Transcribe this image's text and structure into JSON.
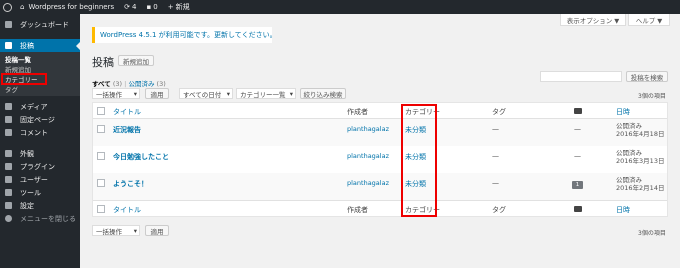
{
  "adminbar": {
    "site_name": "Wordpress for beginners",
    "updates": "4",
    "comments": "0",
    "new": "新規"
  },
  "sidebar": {
    "dashboard": "ダッシュボード",
    "posts": "投稿",
    "sub": [
      "投稿一覧",
      "新規追加",
      "カテゴリー",
      "タグ"
    ],
    "media": "メディア",
    "pages": "固定ページ",
    "comments": "コメント",
    "appearance": "外観",
    "plugins": "プラグイン",
    "users": "ユーザー",
    "tools": "ツール",
    "settings": "設定",
    "collapse": "メニューを閉じる"
  },
  "screen_options": "表示オプション ▼",
  "help": "ヘルプ ▼",
  "notice": {
    "text": "WordPress 4.5.1 が利用可能です。",
    "link": "更新してください。"
  },
  "page_title": "投稿",
  "add_new": "新規追加",
  "filters": {
    "all": "すべて",
    "all_count": "(3)",
    "sep": "|",
    "published": "公開済み",
    "published_count": "(3)"
  },
  "search_button": "投稿を検索",
  "bulk_action": "一括操作",
  "apply": "適用",
  "all_dates": "すべての日付",
  "category_all": "カテゴリー一覧",
  "filter_button": "絞り込み検索",
  "items_count": "3個の項目",
  "columns": {
    "title": "タイトル",
    "author": "作成者",
    "category": "カテゴリー",
    "tags": "タグ",
    "date": "日時"
  },
  "rows": [
    {
      "title": "近況報告",
      "author": "planthagalaz",
      "category": "未分類",
      "tags": "—",
      "comments": "—",
      "date_status": "公開済み",
      "date": "2016年4月18日"
    },
    {
      "title": "今日勉強したこと",
      "author": "planthagalaz",
      "category": "未分類",
      "tags": "—",
      "comments": "—",
      "date_status": "公開済み",
      "date": "2016年3月13日"
    },
    {
      "title": "ようこそ！",
      "author": "planthagalaz",
      "category": "未分類",
      "tags": "—",
      "comments": "1",
      "date_status": "公開済み",
      "date": "2016年2月14日"
    }
  ]
}
